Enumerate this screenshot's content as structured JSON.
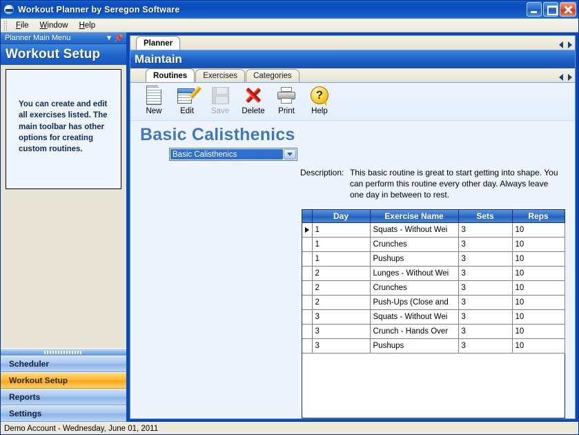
{
  "window": {
    "title": "Workout Planner by Seregon Software",
    "icon": "app-globe-icon",
    "controls": {
      "minimize": "minimize",
      "maximize": "maximize",
      "close": "close"
    }
  },
  "menubar": {
    "items": [
      {
        "label": "File",
        "accel": "F"
      },
      {
        "label": "Window",
        "accel": "W"
      },
      {
        "label": "Help",
        "accel": "H"
      }
    ]
  },
  "sidebar": {
    "caption": "Planner Main Menu",
    "caption_icons": [
      "chevron-down-icon",
      "pushpin-icon"
    ],
    "header": "Workout Setup",
    "info_text": "You can create and edit all exercises listed.  The main toolbar has other options for creating custom routines.",
    "nav": [
      {
        "label": "Scheduler",
        "selected": false
      },
      {
        "label": "Workout Setup",
        "selected": true
      },
      {
        "label": "Reports",
        "selected": false
      },
      {
        "label": "Settings",
        "selected": false
      }
    ]
  },
  "main": {
    "top_tabs": [
      {
        "label": "Planner",
        "active": true
      }
    ],
    "section_header": "Maintain",
    "sub_tabs": [
      {
        "label": "Routines",
        "active": true
      },
      {
        "label": "Exercises",
        "active": false
      },
      {
        "label": "Categories",
        "active": false
      }
    ],
    "toolbar": [
      {
        "label": "New",
        "icon": "new-document-icon",
        "disabled": false
      },
      {
        "label": "Edit",
        "icon": "edit-pencil-icon",
        "disabled": false
      },
      {
        "label": "Save",
        "icon": "save-floppy-icon",
        "disabled": true
      },
      {
        "label": "Delete",
        "icon": "delete-x-icon",
        "disabled": false
      },
      {
        "label": "Print",
        "icon": "print-icon",
        "disabled": false
      },
      {
        "label": "Help",
        "icon": "help-question-icon",
        "disabled": false
      }
    ],
    "routine_title": "Basic Calisthenics",
    "routine_combo_value": "Basic Calisthenics",
    "description_label": "Description:",
    "description_text": "This basic routine is great to start getting into shape. You can perform this routine every other day. Always leave one day in between to rest.",
    "grid": {
      "columns": [
        "Day",
        "Exercise Name",
        "Sets",
        "Reps"
      ],
      "rows": [
        {
          "day": "1",
          "exercise": "Squats - Without Wei",
          "sets": "3",
          "reps": "10",
          "current": true
        },
        {
          "day": "1",
          "exercise": "Crunches",
          "sets": "3",
          "reps": "10",
          "current": false
        },
        {
          "day": "1",
          "exercise": "Pushups",
          "sets": "3",
          "reps": "10",
          "current": false
        },
        {
          "day": "2",
          "exercise": "Lunges - Without Wei",
          "sets": "3",
          "reps": "10",
          "current": false
        },
        {
          "day": "2",
          "exercise": "Crunches",
          "sets": "3",
          "reps": "10",
          "current": false
        },
        {
          "day": "2",
          "exercise": "Push-Ups (Close and",
          "sets": "3",
          "reps": "10",
          "current": false
        },
        {
          "day": "3",
          "exercise": "Squats - Without Wei",
          "sets": "3",
          "reps": "10",
          "current": false
        },
        {
          "day": "3",
          "exercise": "Crunch - Hands Over",
          "sets": "3",
          "reps": "10",
          "current": false
        },
        {
          "day": "3",
          "exercise": "Pushups",
          "sets": "3",
          "reps": "10",
          "current": false
        }
      ]
    }
  },
  "statusbar": {
    "text": "Demo Account - Wednesday, June 01, 2011"
  },
  "colors": {
    "titlebar_blue": "#0a4cbd",
    "accent_orange": "#fcb930",
    "header_blue": "#1b5ec3",
    "grid_header_blue": "#2e6bc4",
    "title_text_blue": "#3e76c0",
    "panel_bg": "#eef4fd",
    "sidebar_bg": "#e9e5d6"
  }
}
